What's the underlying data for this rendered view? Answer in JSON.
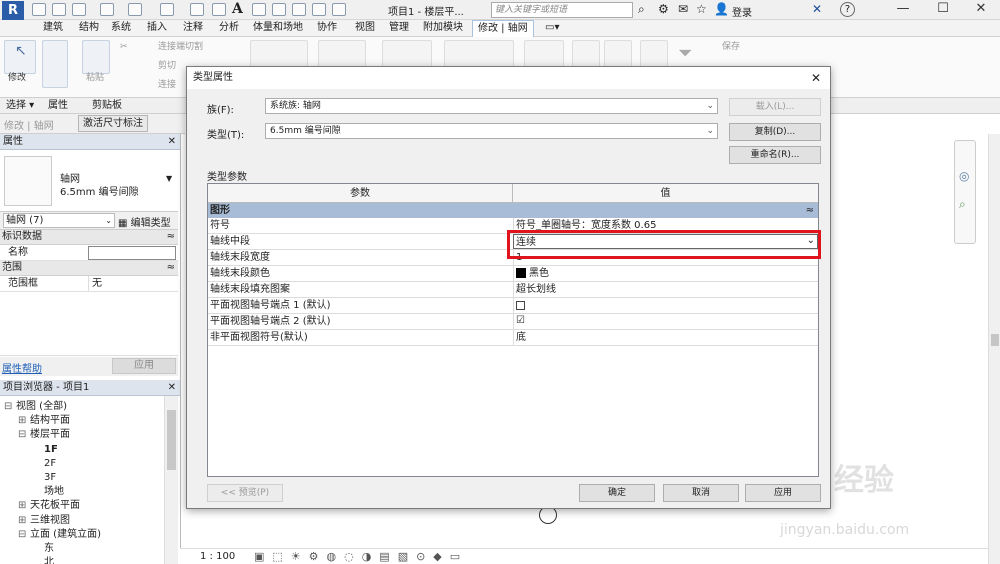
{
  "app": {
    "logo": "R",
    "title": "项目1 - 楼层平...",
    "search_placeholder": "键入关键字或短语",
    "login": "登录",
    "help": "?"
  },
  "window": {
    "minimize": "—",
    "maximize": "☐",
    "close": "✕"
  },
  "ribbon_tabs": [
    "建筑",
    "结构",
    "系统",
    "插入",
    "注释",
    "分析",
    "体量和场地",
    "协作",
    "视图",
    "管理",
    "附加模块",
    "修改 | 轴网"
  ],
  "ribbon": {
    "modify": "修改",
    "paste": "粘贴",
    "connect_cut": "连接端切割",
    "cut": "剪切",
    "join": "连接",
    "save": "保存",
    "panel_labels": [
      "选择 ▾",
      "属性",
      "剪贴板"
    ]
  },
  "context_row": {
    "modify_grid": "修改 | 轴网",
    "activate_dim": "激活尺寸标注"
  },
  "properties": {
    "title": "属性",
    "type_name": "轴网",
    "type_sub": "6.5mm 编号间隙",
    "instance_filter": "轴网 (7)",
    "edit_type": "编辑类型",
    "section_identity": "标识数据",
    "name_label": "名称",
    "name_value": "",
    "section_range": "范围",
    "scope_label": "范围框",
    "scope_value": "无",
    "help_link": "属性帮助",
    "apply": "应用"
  },
  "browser": {
    "title": "项目浏览器 - 项目1",
    "items": [
      {
        "label": "视图 (全部)",
        "level": 0,
        "toggle": "⊟"
      },
      {
        "label": "结构平面",
        "level": 1,
        "toggle": "⊞"
      },
      {
        "label": "楼层平面",
        "level": 1,
        "toggle": "⊟"
      },
      {
        "label": "1F",
        "level": 2,
        "toggle": ""
      },
      {
        "label": "2F",
        "level": 2,
        "toggle": ""
      },
      {
        "label": "3F",
        "level": 2,
        "toggle": ""
      },
      {
        "label": "场地",
        "level": 2,
        "toggle": ""
      },
      {
        "label": "天花板平面",
        "level": 1,
        "toggle": "⊞"
      },
      {
        "label": "三维视图",
        "level": 1,
        "toggle": "⊞"
      },
      {
        "label": "立面 (建筑立面)",
        "level": 1,
        "toggle": "⊟"
      },
      {
        "label": "东",
        "level": 2,
        "toggle": ""
      },
      {
        "label": "北",
        "level": 2,
        "toggle": ""
      }
    ]
  },
  "status": {
    "scale": "1 : 100"
  },
  "dialog": {
    "title": "类型属性",
    "close": "✕",
    "family_label": "族(F):",
    "family_value": "系统族: 轴网",
    "type_label": "类型(T):",
    "type_value": "6.5mm 编号间隙",
    "load_btn": "载入(L)...",
    "duplicate_btn": "复制(D)...",
    "rename_btn": "重命名(R)...",
    "params_label": "类型参数",
    "col_param": "参数",
    "col_value": "值",
    "group_name": "图形",
    "group_toggle": "≈",
    "rows": [
      {
        "param": "符号",
        "value": "符号_单圈轴号：宽度系数 0.65"
      },
      {
        "param": "轴线中段",
        "value": "连续"
      },
      {
        "param": "轴线末段宽度",
        "value": "1"
      },
      {
        "param": "轴线末段颜色",
        "value": "黑色"
      },
      {
        "param": "轴线末段填充图案",
        "value": "超长划线"
      },
      {
        "param": "平面视图轴号端点 1 (默认)",
        "value": ""
      },
      {
        "param": "平面视图轴号端点 2 (默认)",
        "value": "☑"
      },
      {
        "param": "非平面视图符号(默认)",
        "value": "底"
      }
    ],
    "preview_btn": "<< 预览(P)",
    "ok_btn": "确定",
    "cancel_btn": "取消",
    "apply_btn": "应用"
  },
  "colors": {
    "highlight": "#e0141c",
    "group_header": "#a8bcd8",
    "swatch": "#000000"
  }
}
